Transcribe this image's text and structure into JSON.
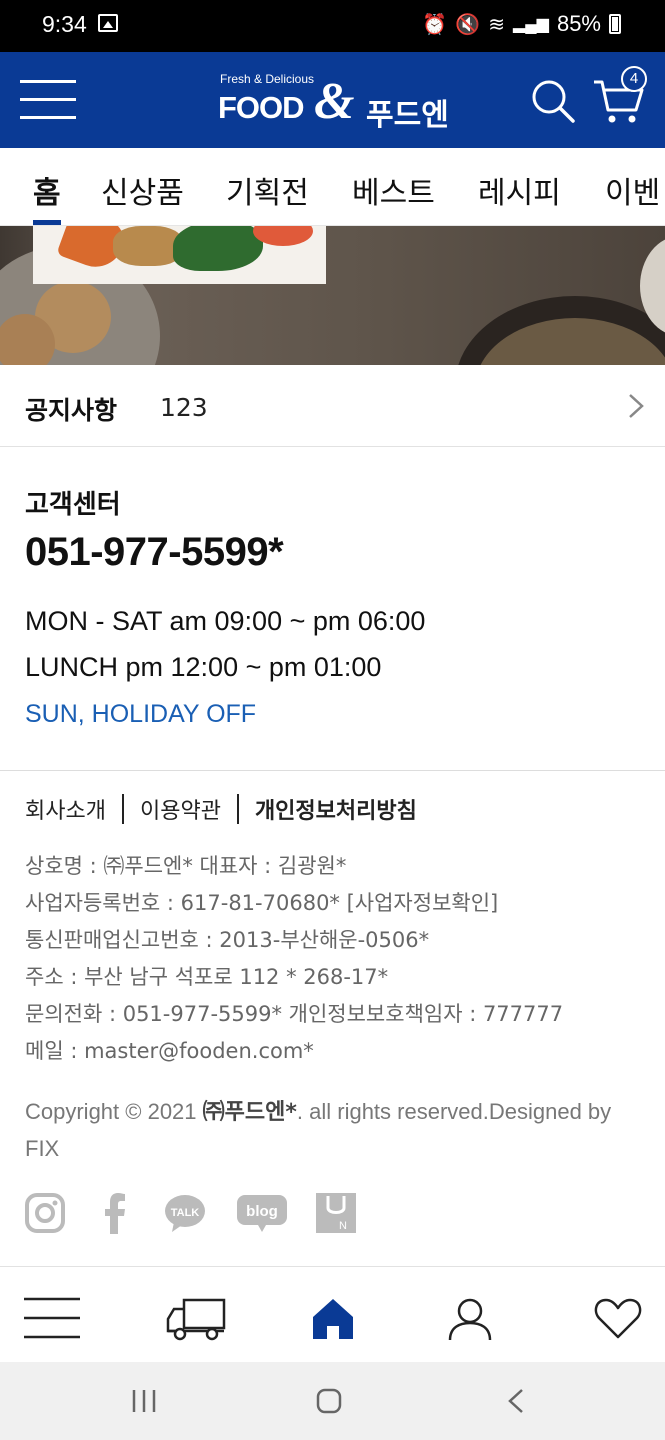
{
  "status_bar": {
    "time": "9:34",
    "battery": "85%"
  },
  "header": {
    "logo_tagline": "Fresh & Delicious",
    "logo_food": "FOOD",
    "logo_amp": "&",
    "logo_korean": "푸드엔",
    "cart_count": "4",
    "accent_color": "#0a3a95"
  },
  "tabs": [
    {
      "label": "홈",
      "active": true
    },
    {
      "label": "신상품"
    },
    {
      "label": "기획전"
    },
    {
      "label": "베스트"
    },
    {
      "label": "레시피"
    },
    {
      "label": "이벤"
    }
  ],
  "notice": {
    "title": "공지사항",
    "text": "123"
  },
  "customer_center": {
    "title": "고객센터",
    "phone": "051-977-5599*",
    "hours": "MON - SAT am 09:00 ~ pm 06:00",
    "lunch": "LUNCH pm 12:00 ~ pm 01:00",
    "off": "SUN, HOLIDAY OFF"
  },
  "footer": {
    "links": [
      "회사소개",
      "이용약관",
      "개인정보처리방침"
    ],
    "info": [
      "상호명 : ㈜푸드엔*    대표자 : 김광원*",
      "사업자등록번호 : 617-81-70680* [사업자정보확인]",
      "통신판매업신고번호 : 2013-부산해운-0506*",
      "주소 : 부산 남구 석포로 112 * 268-17*",
      "문의전화 : 051-977-5599*    개인정보보호책임자 : 777777",
      "메일 : master@fooden.com*"
    ],
    "copyright_prefix": "Copyright © 2021 ",
    "copyright_company": "㈜푸드엔*",
    "copyright_suffix": ". all rights reserved.Designed by FIX",
    "sns": [
      "instagram-icon",
      "facebook-icon",
      "kakaotalk-icon",
      "blog-icon",
      "un-icon"
    ],
    "sns_talk_label": "TALK",
    "sns_blog_label": "blog",
    "sns_un_label": "N"
  },
  "bottom_nav": [
    "menu-icon",
    "delivery-truck-icon",
    "home-icon",
    "user-icon",
    "heart-icon"
  ]
}
